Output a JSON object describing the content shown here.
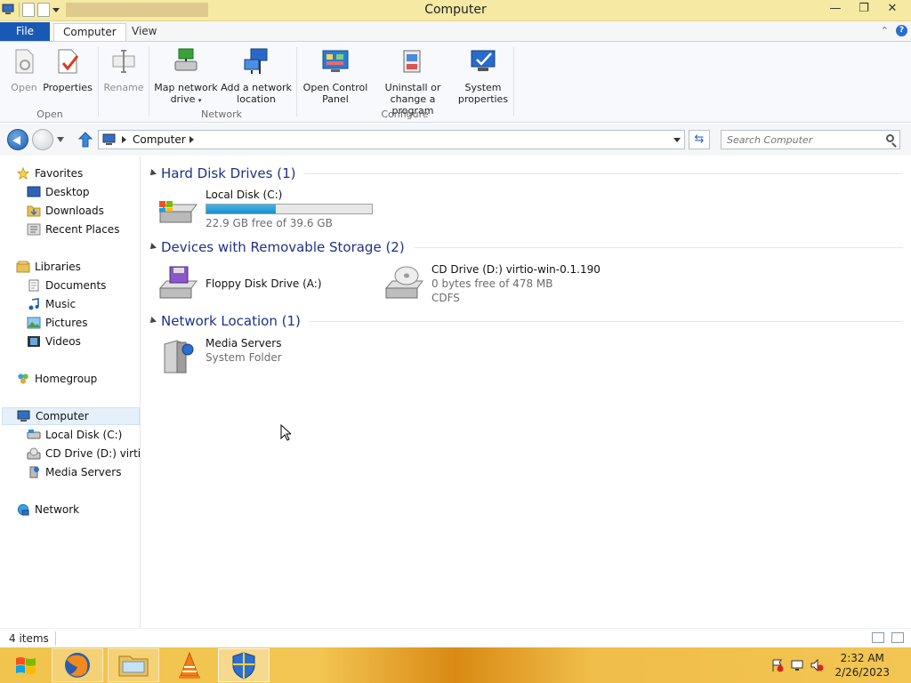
{
  "window": {
    "title": "Computer"
  },
  "ribbon_tabs": {
    "file": "File",
    "computer": "Computer",
    "view": "View"
  },
  "ribbon": {
    "groups": {
      "open": "Open",
      "network": "Network",
      "configure": "Configure"
    },
    "buttons": {
      "open": "Open",
      "properties": "Properties",
      "rename": "Rename",
      "map_network_drive_1": "Map network",
      "map_network_drive_2": "drive",
      "add_network_location_1": "Add a network",
      "add_network_location_2": "location",
      "open_control_panel_1": "Open Control",
      "open_control_panel_2": "Panel",
      "uninstall_1": "Uninstall or",
      "uninstall_2": "change a program",
      "system_properties_1": "System",
      "system_properties_2": "properties"
    }
  },
  "address": {
    "breadcrumb": "Computer",
    "search_placeholder": "Search Computer"
  },
  "nav": {
    "favorites": "Favorites",
    "desktop": "Desktop",
    "downloads": "Downloads",
    "recent_places": "Recent Places",
    "libraries": "Libraries",
    "documents": "Documents",
    "music": "Music",
    "pictures": "Pictures",
    "videos": "Videos",
    "homegroup": "Homegroup",
    "computer": "Computer",
    "local_disk": "Local Disk (C:)",
    "cd_drive": "CD Drive (D:) virtio-w",
    "media_servers": "Media Servers",
    "network": "Network"
  },
  "content": {
    "groups": {
      "hdd": "Hard Disk Drives (1)",
      "removable": "Devices with Removable Storage (2)",
      "network": "Network Location (1)"
    },
    "local_disk": {
      "name": "Local Disk (C:)",
      "free": "22.9 GB free of 39.6 GB",
      "used_fraction": 0.42
    },
    "floppy": {
      "name": "Floppy Disk Drive (A:)"
    },
    "cd": {
      "name": "CD Drive (D:) virtio-win-0.1.190",
      "free": "0 bytes free of 478 MB",
      "fs": "CDFS"
    },
    "media": {
      "name": "Media Servers",
      "type": "System Folder"
    }
  },
  "status": {
    "count": "4 items"
  },
  "clock": {
    "time": "2:32 AM",
    "date": "2/26/2023"
  },
  "colors": {
    "accent": "#1959b5",
    "group_header": "#1e3287",
    "titlebar": "#f5e9a3",
    "taskbar": "#f3c552"
  }
}
